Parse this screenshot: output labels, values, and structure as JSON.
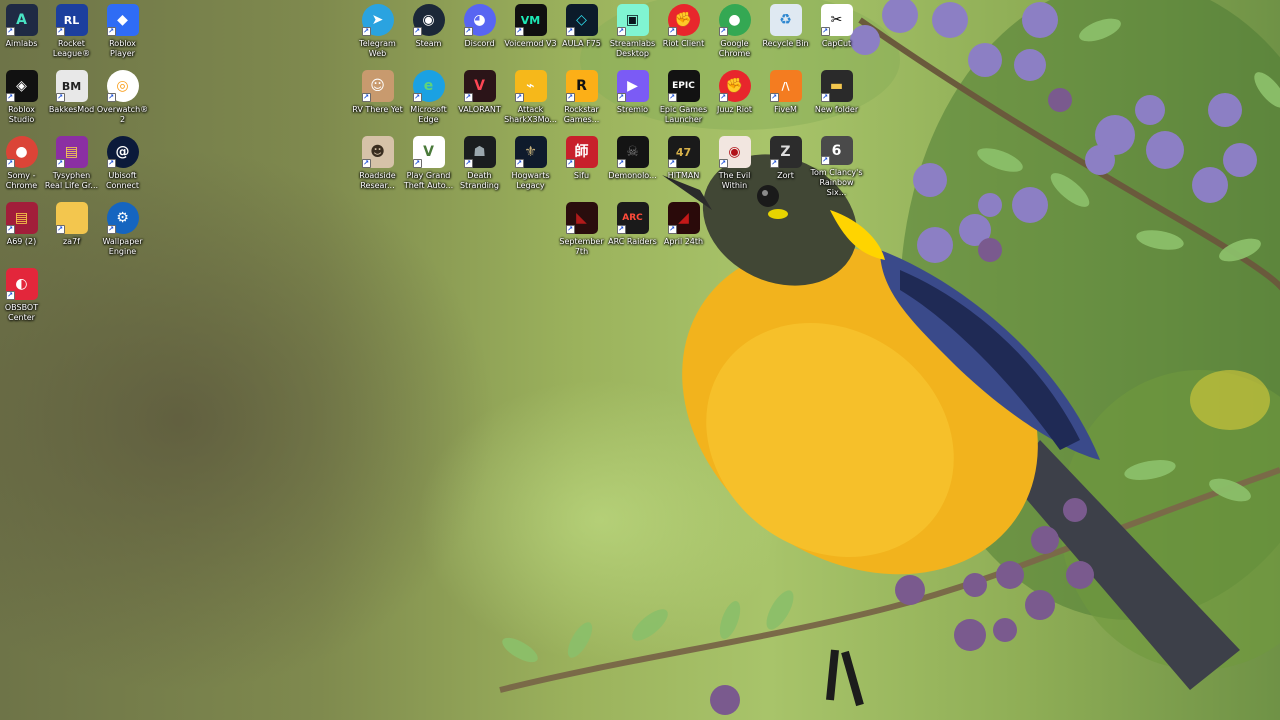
{
  "desktop": {
    "icons": [
      {
        "id": "aimlabs",
        "label": "Aimlabs",
        "icon": "aimlabs-icon",
        "bg": "#1f2a44",
        "fg": "#49e3c4",
        "glyph": "A",
        "round": false
      },
      {
        "id": "rocket-league",
        "label": "Rocket League®",
        "icon": "rocket-league-icon",
        "bg": "#1c3f9e",
        "fg": "#ffffff",
        "glyph": "RL",
        "round": false
      },
      {
        "id": "roblox-player",
        "label": "Roblox Player",
        "icon": "roblox-icon",
        "bg": "#2f6cf5",
        "fg": "#ffffff",
        "glyph": "◆",
        "round": false
      },
      {
        "id": "roblox-studio",
        "label": "Roblox Studio",
        "icon": "roblox-studio-icon",
        "bg": "#111111",
        "fg": "#ffffff",
        "glyph": "◈",
        "round": false
      },
      {
        "id": "bakkesmod",
        "label": "BakkesMod",
        "icon": "bakkesmod-icon",
        "bg": "#e8e8e8",
        "fg": "#222222",
        "glyph": "BM",
        "round": false
      },
      {
        "id": "overwatch",
        "label": "Overwatch® 2",
        "icon": "overwatch-icon",
        "bg": "#ffffff",
        "fg": "#f99e1a",
        "glyph": "◎",
        "round": true
      },
      {
        "id": "somy-chrome",
        "label": "Somy - Chrome",
        "icon": "chrome-icon",
        "bg": "#db4437",
        "fg": "#ffffff",
        "glyph": "●",
        "round": true
      },
      {
        "id": "tysyphen",
        "label": "Tysyphen Real Life Gr...",
        "icon": "archive-icon",
        "bg": "#8b2fa3",
        "fg": "#ffd84a",
        "glyph": "▤",
        "round": false
      },
      {
        "id": "ubisoft-connect",
        "label": "Ubisoft Connect",
        "icon": "ubisoft-icon",
        "bg": "#0b1a3a",
        "fg": "#ffffff",
        "glyph": "@",
        "round": true
      },
      {
        "id": "a69",
        "label": "A69 (2)",
        "icon": "winrar-icon",
        "bg": "#a21e3a",
        "fg": "#ffd84a",
        "glyph": "▤",
        "round": false
      },
      {
        "id": "za7f",
        "label": "za7f",
        "icon": "folder-icon",
        "bg": "#f3c64e",
        "fg": "#c79a22",
        "glyph": "",
        "round": false
      },
      {
        "id": "wallpaper-engine",
        "label": "Wallpaper Engine",
        "icon": "wallpaper-engine-icon",
        "bg": "#1565c0",
        "fg": "#ffffff",
        "glyph": "⚙",
        "round": true
      },
      {
        "id": "obsbot-center",
        "label": "OBSBOT Center",
        "icon": "obsbot-icon",
        "bg": "#e3263b",
        "fg": "#ffffff",
        "glyph": "◐",
        "round": false
      },
      {
        "id": "telegram-web",
        "label": "Telegram Web",
        "icon": "telegram-icon",
        "bg": "#2aa3e0",
        "fg": "#ffffff",
        "glyph": "➤",
        "round": true
      },
      {
        "id": "steam",
        "label": "Steam",
        "icon": "steam-icon",
        "bg": "#1b2838",
        "fg": "#ffffff",
        "glyph": "◉",
        "round": true
      },
      {
        "id": "discord",
        "label": "Discord",
        "icon": "discord-icon",
        "bg": "#5865f2",
        "fg": "#ffffff",
        "glyph": "◕",
        "round": true
      },
      {
        "id": "voicemod",
        "label": "Voicemod V3",
        "icon": "voicemod-icon",
        "bg": "#101010",
        "fg": "#1de9b6",
        "glyph": "VM",
        "round": false
      },
      {
        "id": "aula-f75",
        "label": "AULA F75",
        "icon": "aula-icon",
        "bg": "#0c1b2a",
        "fg": "#2fe0f0",
        "glyph": "◇",
        "round": false
      },
      {
        "id": "streamlabs",
        "label": "Streamlabs Desktop",
        "icon": "streamlabs-icon",
        "bg": "#80f5d2",
        "fg": "#09161d",
        "glyph": "▣",
        "round": false
      },
      {
        "id": "riot-client",
        "label": "Riot Client",
        "icon": "riot-icon",
        "bg": "#e8262c",
        "fg": "#ffffff",
        "glyph": "✊",
        "round": true
      },
      {
        "id": "google-chrome",
        "label": "Google Chrome",
        "icon": "chrome-icon",
        "bg": "#34a853",
        "fg": "#ffffff",
        "glyph": "●",
        "round": true
      },
      {
        "id": "recycle-bin",
        "label": "Recycle Bin",
        "icon": "recycle-bin-icon",
        "bg": "#dfe9f2",
        "fg": "#2f88d0",
        "glyph": "♻",
        "round": false
      },
      {
        "id": "capcut",
        "label": "CapCut",
        "icon": "capcut-icon",
        "bg": "#ffffff",
        "fg": "#000000",
        "glyph": "✂",
        "round": false
      },
      {
        "id": "rv-there-yet",
        "label": "RV There Yet",
        "icon": "game-rv-icon",
        "bg": "#c89a6e",
        "fg": "#ffffff",
        "glyph": "☺",
        "round": false
      },
      {
        "id": "microsoft-edge",
        "label": "Microsoft Edge",
        "icon": "edge-icon",
        "bg": "#1ba1e2",
        "fg": "#5fd37a",
        "glyph": "e",
        "round": true
      },
      {
        "id": "valorant",
        "label": "VALORANT",
        "icon": "valorant-icon",
        "bg": "#2b1418",
        "fg": "#ff4655",
        "glyph": "V",
        "round": false
      },
      {
        "id": "attack-shark",
        "label": "Attack SharkX3Mo...",
        "icon": "attack-shark-icon",
        "bg": "#f6b81a",
        "fg": "#ffffff",
        "glyph": "⌁",
        "round": false
      },
      {
        "id": "rockstar-games",
        "label": "Rockstar Games...",
        "icon": "rockstar-icon",
        "bg": "#fcaf17",
        "fg": "#111111",
        "glyph": "R",
        "round": false
      },
      {
        "id": "stremio",
        "label": "Stremio",
        "icon": "stremio-icon",
        "bg": "#7b5bf5",
        "fg": "#ffffff",
        "glyph": "▶",
        "round": false
      },
      {
        "id": "epic-games",
        "label": "Epic Games Launcher",
        "icon": "epic-games-icon",
        "bg": "#121212",
        "fg": "#ffffff",
        "glyph": "EPIC",
        "round": false
      },
      {
        "id": "juuz-riot",
        "label": "Juuz Riot",
        "icon": "riot-icon",
        "bg": "#e8262c",
        "fg": "#ffffff",
        "glyph": "✊",
        "round": true
      },
      {
        "id": "fivem",
        "label": "FiveM",
        "icon": "fivem-icon",
        "bg": "#f47c20",
        "fg": "#ffffff",
        "glyph": "/\\",
        "round": false
      },
      {
        "id": "new-folder",
        "label": "New folder",
        "icon": "folder-icon",
        "bg": "#2a2a2a",
        "fg": "#f3c64e",
        "glyph": "▬",
        "round": false
      },
      {
        "id": "roadside-research",
        "label": "Roadside Resear...",
        "icon": "game-roadside-icon",
        "bg": "#d6c2a8",
        "fg": "#3a2d1f",
        "glyph": "☻",
        "round": false
      },
      {
        "id": "gta-v",
        "label": "Play Grand Theft Auto...",
        "icon": "gta-icon",
        "bg": "#ffffff",
        "fg": "#4a7a3a",
        "glyph": "V",
        "round": false
      },
      {
        "id": "death-stranding",
        "label": "Death Stranding",
        "icon": "death-stranding-icon",
        "bg": "#1a1d1f",
        "fg": "#9aa7ad",
        "glyph": "☗",
        "round": false
      },
      {
        "id": "hogwarts-legacy",
        "label": "Hogwarts Legacy",
        "icon": "hogwarts-icon",
        "bg": "#0f1b2c",
        "fg": "#c9b37a",
        "glyph": "⚜",
        "round": false
      },
      {
        "id": "sifu",
        "label": "Sifu",
        "icon": "sifu-icon",
        "bg": "#c8202b",
        "fg": "#ffffff",
        "glyph": "師",
        "round": false
      },
      {
        "id": "demonologist",
        "label": "Demonolo...",
        "icon": "demonologist-icon",
        "bg": "#141414",
        "fg": "#7a7a7a",
        "glyph": "☠",
        "round": false
      },
      {
        "id": "hitman",
        "label": "HITMAN",
        "icon": "hitman-icon",
        "bg": "#1a1a1a",
        "fg": "#d8b24a",
        "glyph": "47",
        "round": false
      },
      {
        "id": "the-evil-within",
        "label": "The Evil Within",
        "icon": "evil-within-icon",
        "bg": "#f2e6e0",
        "fg": "#b0121a",
        "glyph": "◉",
        "round": false
      },
      {
        "id": "zort",
        "label": "Zort",
        "icon": "zort-icon",
        "bg": "#2c2c2c",
        "fg": "#dddddd",
        "glyph": "Z",
        "round": false
      },
      {
        "id": "rainbow-six",
        "label": "Tom Clancy's Rainbow Six...",
        "icon": "rainbow-six-icon",
        "bg": "#4a4a4a",
        "fg": "#ffffff",
        "glyph": "6",
        "round": false
      },
      {
        "id": "september-7th",
        "label": "September 7th",
        "icon": "game-september-icon",
        "bg": "#2a0d0d",
        "fg": "#b11a1a",
        "glyph": "◣",
        "round": false
      },
      {
        "id": "arc-raiders",
        "label": "ARC Raiders",
        "icon": "arc-raiders-icon",
        "bg": "#1a1a1a",
        "fg": "#ff4b3a",
        "glyph": "ARC",
        "round": false
      },
      {
        "id": "april-24th",
        "label": "April 24th",
        "icon": "game-april-icon",
        "bg": "#2a0a0a",
        "fg": "#c41818",
        "glyph": "◢",
        "round": false
      }
    ]
  }
}
